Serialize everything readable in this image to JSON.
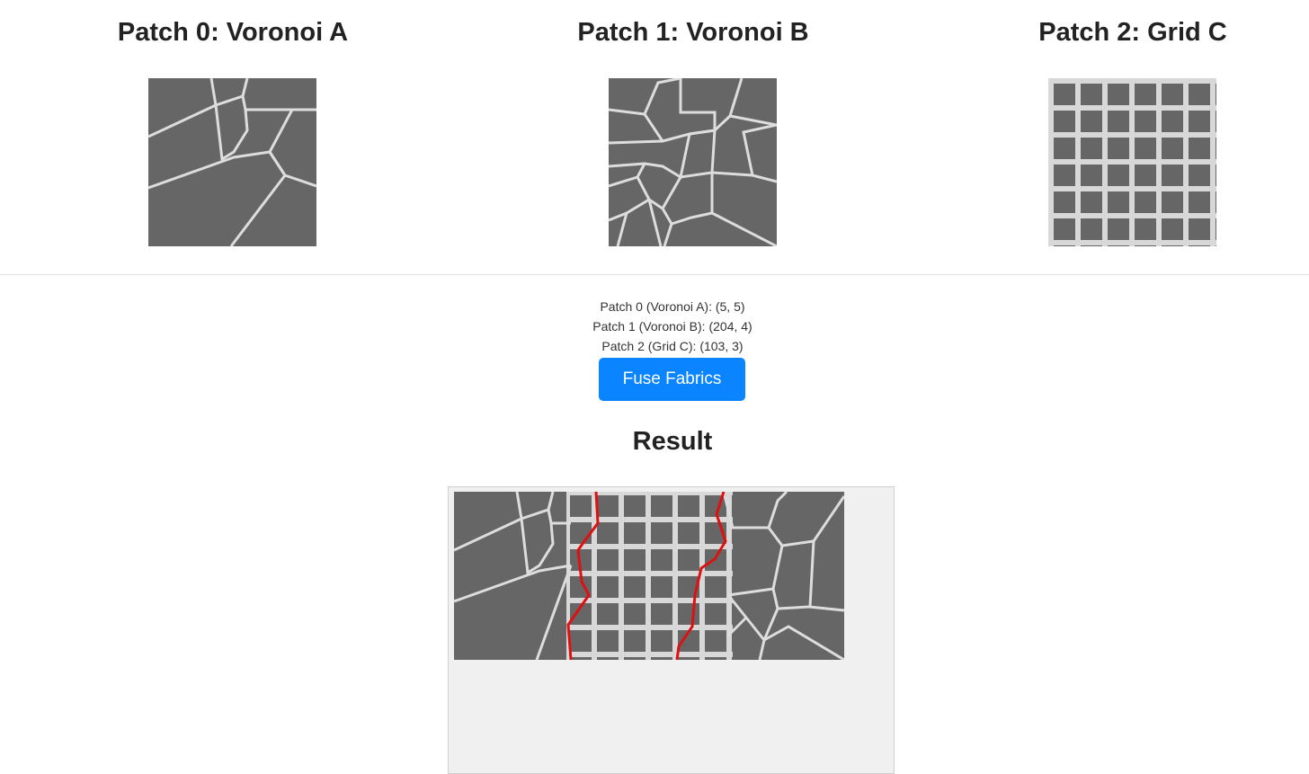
{
  "patches": [
    {
      "title": "Patch 0: Voronoi A"
    },
    {
      "title": "Patch 1: Voronoi B"
    },
    {
      "title": "Patch 2: Grid C"
    }
  ],
  "coords": [
    "Patch 0 (Voronoi A): (5, 5)",
    "Patch 1 (Voronoi B): (204, 4)",
    "Patch 2 (Grid C): (103, 3)"
  ],
  "fuse_button": {
    "label": "Fuse Fabrics"
  },
  "result": {
    "title": "Result"
  },
  "colors": {
    "fabric": "#666666",
    "seam_line": "#dddddd",
    "cut_line": "#dd1111",
    "button": "#0a84ff"
  }
}
